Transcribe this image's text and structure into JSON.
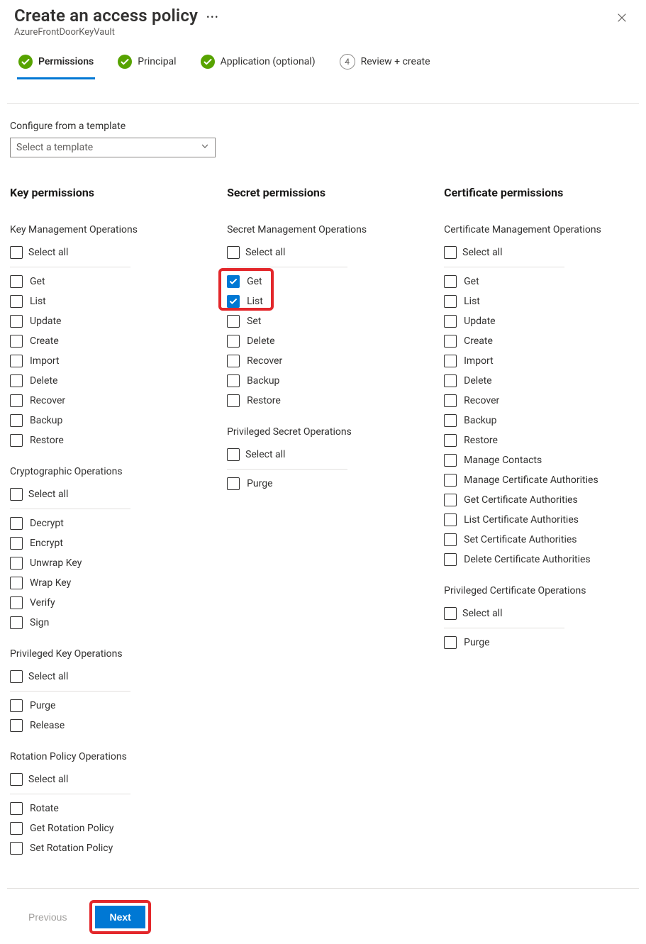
{
  "header": {
    "title": "Create an access policy",
    "subtitle": "AzureFrontDoorKeyVault"
  },
  "steps": [
    {
      "label": "Permissions",
      "done": true,
      "active": true
    },
    {
      "label": "Principal",
      "done": true,
      "active": false
    },
    {
      "label": "Application (optional)",
      "done": true,
      "active": false
    },
    {
      "label": "Review + create",
      "done": false,
      "active": false,
      "num": "4"
    }
  ],
  "template": {
    "label": "Configure from a template",
    "placeholder": "Select a template"
  },
  "columns": {
    "key": {
      "title": "Key permissions",
      "groups": [
        {
          "title": "Key Management Operations",
          "select_all": "Select all",
          "items": [
            {
              "label": "Get",
              "checked": false
            },
            {
              "label": "List",
              "checked": false
            },
            {
              "label": "Update",
              "checked": false
            },
            {
              "label": "Create",
              "checked": false
            },
            {
              "label": "Import",
              "checked": false
            },
            {
              "label": "Delete",
              "checked": false
            },
            {
              "label": "Recover",
              "checked": false
            },
            {
              "label": "Backup",
              "checked": false
            },
            {
              "label": "Restore",
              "checked": false
            }
          ]
        },
        {
          "title": "Cryptographic Operations",
          "select_all": "Select all",
          "items": [
            {
              "label": "Decrypt",
              "checked": false
            },
            {
              "label": "Encrypt",
              "checked": false
            },
            {
              "label": "Unwrap Key",
              "checked": false
            },
            {
              "label": "Wrap Key",
              "checked": false
            },
            {
              "label": "Verify",
              "checked": false
            },
            {
              "label": "Sign",
              "checked": false
            }
          ]
        },
        {
          "title": "Privileged Key Operations",
          "select_all": "Select all",
          "items": [
            {
              "label": "Purge",
              "checked": false
            },
            {
              "label": "Release",
              "checked": false
            }
          ]
        },
        {
          "title": "Rotation Policy Operations",
          "select_all": "Select all",
          "items": [
            {
              "label": "Rotate",
              "checked": false
            },
            {
              "label": "Get Rotation Policy",
              "checked": false
            },
            {
              "label": "Set Rotation Policy",
              "checked": false
            }
          ]
        }
      ]
    },
    "secret": {
      "title": "Secret permissions",
      "groups": [
        {
          "title": "Secret Management Operations",
          "select_all": "Select all",
          "highlight": true,
          "items": [
            {
              "label": "Get",
              "checked": true
            },
            {
              "label": "List",
              "checked": true
            },
            {
              "label": "Set",
              "checked": false
            },
            {
              "label": "Delete",
              "checked": false
            },
            {
              "label": "Recover",
              "checked": false
            },
            {
              "label": "Backup",
              "checked": false
            },
            {
              "label": "Restore",
              "checked": false
            }
          ]
        },
        {
          "title": "Privileged Secret Operations",
          "select_all": "Select all",
          "items": [
            {
              "label": "Purge",
              "checked": false
            }
          ]
        }
      ]
    },
    "cert": {
      "title": "Certificate permissions",
      "groups": [
        {
          "title": "Certificate Management Operations",
          "select_all": "Select all",
          "items": [
            {
              "label": "Get",
              "checked": false
            },
            {
              "label": "List",
              "checked": false
            },
            {
              "label": "Update",
              "checked": false
            },
            {
              "label": "Create",
              "checked": false
            },
            {
              "label": "Import",
              "checked": false
            },
            {
              "label": "Delete",
              "checked": false
            },
            {
              "label": "Recover",
              "checked": false
            },
            {
              "label": "Backup",
              "checked": false
            },
            {
              "label": "Restore",
              "checked": false
            },
            {
              "label": "Manage Contacts",
              "checked": false
            },
            {
              "label": "Manage Certificate Authorities",
              "checked": false
            },
            {
              "label": "Get Certificate Authorities",
              "checked": false
            },
            {
              "label": "List Certificate Authorities",
              "checked": false
            },
            {
              "label": "Set Certificate Authorities",
              "checked": false
            },
            {
              "label": "Delete Certificate Authorities",
              "checked": false
            }
          ]
        },
        {
          "title": "Privileged Certificate Operations",
          "select_all": "Select all",
          "items": [
            {
              "label": "Purge",
              "checked": false
            }
          ]
        }
      ]
    }
  },
  "footer": {
    "previous": "Previous",
    "next": "Next"
  }
}
